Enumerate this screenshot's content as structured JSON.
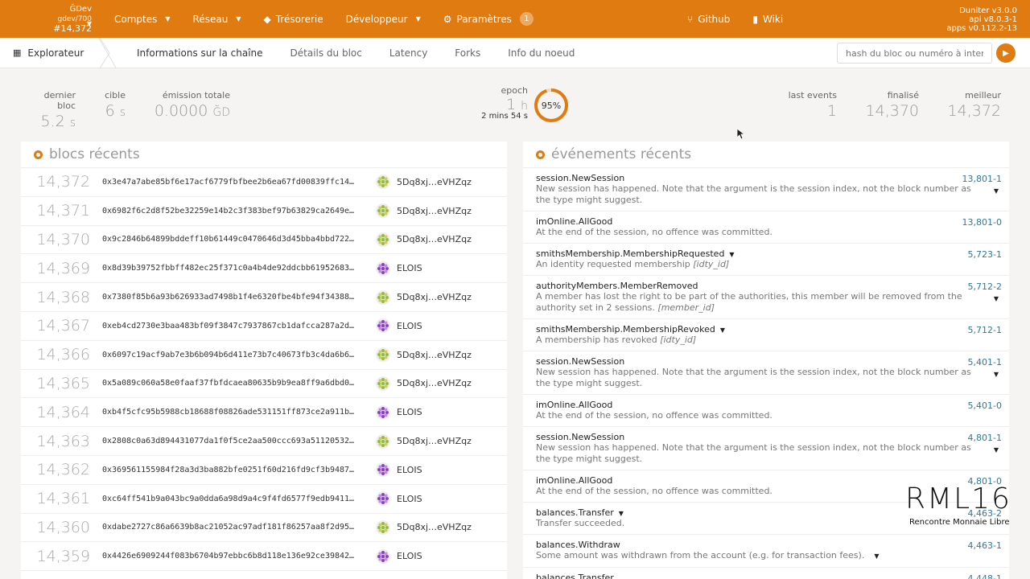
{
  "topbar": {
    "chain_symbol": "ĞDev",
    "chain_name": "gdev/700",
    "chain_block": "#14,372",
    "nav": [
      {
        "label": "Comptes",
        "icon": "",
        "caret": true
      },
      {
        "label": "Réseau",
        "icon": "",
        "caret": true
      },
      {
        "label": "Trésorerie",
        "icon": "gem-icon",
        "caret": false
      },
      {
        "label": "Développeur",
        "icon": "",
        "caret": true
      }
    ],
    "settings_label": "Paramètres",
    "settings_badge": "1",
    "github_label": "Github",
    "wiki_label": "Wiki",
    "version_line1": "Duniter v3.0.0",
    "version_line2": "api v8.0.3-1",
    "version_line3": "apps v0.112.2-13",
    "color": "#e07b12"
  },
  "subbar": {
    "explorer_label": "Explorateur",
    "tabs": [
      "Informations sur la chaîne",
      "Détails du bloc",
      "Latency",
      "Forks",
      "Info du noeud"
    ],
    "search_placeholder": "hash du bloc ou numéro à interroger"
  },
  "stats": {
    "last_block_label": "dernier bloc",
    "last_block_value": "5.2",
    "last_block_unit": "s",
    "target_label": "cible",
    "target_value": "6",
    "target_unit": "s",
    "issuance_label": "émission totale",
    "issuance_value": "0.0000",
    "issuance_unit": "ĞD",
    "epoch_label": "epoch",
    "epoch_value": "1",
    "epoch_unit": "h",
    "epoch_remaining": "2 mins 54 s",
    "epoch_percent": 95,
    "epoch_percent_label": "95%",
    "last_events_label": "last events",
    "last_events_value": "1",
    "finalized_label": "finalisé",
    "finalized_value": "14,370",
    "best_label": "meilleur",
    "best_value": "14,372"
  },
  "blocks_title": "blocs récents",
  "blocks": [
    {
      "number": "14,372",
      "hash": "0x3e47a7abe85bf6e17acf6779fbfbee2b6ea67fd00839ffc14…",
      "author": "5Dq8xj…eVHZqz",
      "identicon": "green-identicon"
    },
    {
      "number": "14,371",
      "hash": "0x6982f6c2d8f52be32259e14b2c3f383bef97b63829ca2649e…",
      "author": "5Dq8xj…eVHZqz",
      "identicon": "green-identicon"
    },
    {
      "number": "14,370",
      "hash": "0x9c2846b64899bddeff10b61449c0470646d3d45bba4bbd722…",
      "author": "5Dq8xj…eVHZqz",
      "identicon": "green-identicon"
    },
    {
      "number": "14,369",
      "hash": "0x8d39b39752fbbff482ec25f371c0a4b4de92ddcbb61952683…",
      "author": "ELOIS",
      "identicon": "purple-identicon"
    },
    {
      "number": "14,368",
      "hash": "0x7380f85b6a93b626933ad7498b1f4e6320fbe4bfe94f34388…",
      "author": "5Dq8xj…eVHZqz",
      "identicon": "green-identicon"
    },
    {
      "number": "14,367",
      "hash": "0xeb4cd2730e3baa483bf09f3847c7937867cb1dafcca287a2d…",
      "author": "ELOIS",
      "identicon": "purple-identicon"
    },
    {
      "number": "14,366",
      "hash": "0x6097c19acf9ab7e3b6b094b6d411e73b7c40673fb3c4da6b6…",
      "author": "5Dq8xj…eVHZqz",
      "identicon": "green-identicon"
    },
    {
      "number": "14,365",
      "hash": "0x5a089c060a58e0faaf37fbfdcaea80635b9b9ea8ff9a6dbd0…",
      "author": "5Dq8xj…eVHZqz",
      "identicon": "green-identicon"
    },
    {
      "number": "14,364",
      "hash": "0xb4f5cfc95b5988cb18688f08826ade531151ff873ce2a911b…",
      "author": "ELOIS",
      "identicon": "purple-identicon"
    },
    {
      "number": "14,363",
      "hash": "0x2808c0a63d894431077da1f0f5ce2aa500ccc693a51120532…",
      "author": "5Dq8xj…eVHZqz",
      "identicon": "green-identicon"
    },
    {
      "number": "14,362",
      "hash": "0x369561155984f28a3d3ba882bfe0251f60d216fd9cf3b9487…",
      "author": "ELOIS",
      "identicon": "purple-identicon"
    },
    {
      "number": "14,361",
      "hash": "0xc64ff541b9a043bc9a0dda6a98d9a4c9f4fd6577f9edb9411…",
      "author": "ELOIS",
      "identicon": "purple-identicon"
    },
    {
      "number": "14,360",
      "hash": "0xdabe2727c86a6639b8ac21052ac97adf181f86257aa8f2d95…",
      "author": "5Dq8xj…eVHZqz",
      "identicon": "green-identicon"
    },
    {
      "number": "14,359",
      "hash": "0x4426e6909244f083b6704b97ebbc6b8d118e136e92ce39842…",
      "author": "ELOIS",
      "identicon": "purple-identicon"
    }
  ],
  "events_title": "événements récents",
  "events": [
    {
      "name": "session.NewSession",
      "desc": "New session has happened. Note that the argument is the session index, not the block number as the type might suggest.",
      "arg": "",
      "id": "13,801-1",
      "toggle": "right"
    },
    {
      "name": "imOnline.AllGood",
      "desc": "At the end of the session, no offence was committed.",
      "arg": "",
      "id": "13,801-0",
      "toggle": ""
    },
    {
      "name": "smithsMembership.MembershipRequested",
      "desc": "An identity requested membership",
      "arg": "[idty_id]",
      "id": "5,723-1",
      "toggle": "inline"
    },
    {
      "name": "authorityMembers.MemberRemoved",
      "desc": "A member has lost the right to be part of the authorities, this member will be removed from the authority set in 2 sessions.",
      "arg": "[member_id]",
      "id": "5,712-2",
      "toggle": "right"
    },
    {
      "name": "smithsMembership.MembershipRevoked",
      "desc": "A membership has revoked",
      "arg": "[idty_id]",
      "id": "5,712-1",
      "toggle": "inline"
    },
    {
      "name": "session.NewSession",
      "desc": "New session has happened. Note that the argument is the session index, not the block number as the type might suggest.",
      "arg": "",
      "id": "5,401-1",
      "toggle": "right"
    },
    {
      "name": "imOnline.AllGood",
      "desc": "At the end of the session, no offence was committed.",
      "arg": "",
      "id": "5,401-0",
      "toggle": ""
    },
    {
      "name": "session.NewSession",
      "desc": "New session has happened. Note that the argument is the session index, not the block number as the type might suggest.",
      "arg": "",
      "id": "4,801-1",
      "toggle": "right"
    },
    {
      "name": "imOnline.AllGood",
      "desc": "At the end of the session, no offence was committed.",
      "arg": "",
      "id": "4,801-0",
      "toggle": ""
    },
    {
      "name": "balances.Transfer",
      "desc": "Transfer succeeded.",
      "arg": "",
      "id": "4,463-2",
      "toggle": "inline"
    },
    {
      "name": "balances.Withdraw",
      "desc": "Some amount was withdrawn from the account (e.g. for transaction fees).",
      "arg": "",
      "id": "4,463-1",
      "toggle": "inline"
    },
    {
      "name": "balances.Transfer",
      "desc": "",
      "arg": "",
      "id": "4,448-1",
      "toggle": ""
    }
  ],
  "watermark": {
    "title": "RML16",
    "subtitle": "Rencontre Monnaie Libre"
  }
}
